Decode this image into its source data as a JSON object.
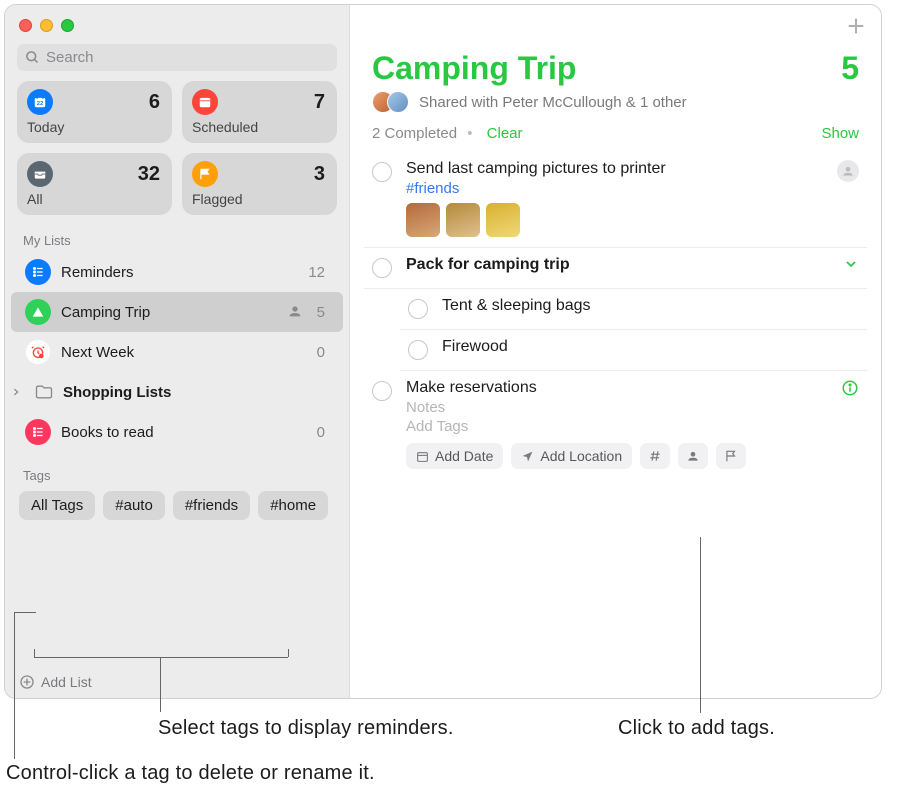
{
  "search": {
    "placeholder": "Search"
  },
  "smart": {
    "today": {
      "label": "Today",
      "count": "6",
      "color": "#0a7aff"
    },
    "scheduled": {
      "label": "Scheduled",
      "count": "7",
      "color": "#ff453a"
    },
    "all": {
      "label": "All",
      "count": "32",
      "color": "#5b6770"
    },
    "flagged": {
      "label": "Flagged",
      "count": "3",
      "color": "#ff9f0a"
    }
  },
  "sidebar": {
    "mylists_header": "My Lists",
    "tags_header": "Tags",
    "lists": [
      {
        "name": "Reminders",
        "count": "12",
        "color": "#0a7aff",
        "icon": "bullet"
      },
      {
        "name": "Camping Trip",
        "count": "5",
        "color": "#30d158",
        "icon": "tent",
        "selected": true,
        "shared": true
      },
      {
        "name": "Next Week",
        "count": "0",
        "color_bg": "#ffffff",
        "icon": "alarm"
      },
      {
        "name": "Shopping Lists",
        "folder": true
      },
      {
        "name": "Books to read",
        "count": "0",
        "color": "#ff375f",
        "icon": "bullet"
      }
    ],
    "tags": [
      {
        "label": "All Tags"
      },
      {
        "label": "#auto"
      },
      {
        "label": "#friends"
      },
      {
        "label": "#home"
      }
    ],
    "add_list": "Add List"
  },
  "main": {
    "title": "Camping Trip",
    "count": "5",
    "shared_text": "Shared with Peter McCullough & 1 other",
    "completed_text": "2 Completed",
    "clear": "Clear",
    "show": "Show",
    "reminders": [
      {
        "title": "Send last camping pictures to printer",
        "tag": "#friends",
        "has_thumbs": true,
        "has_assignee": true
      },
      {
        "title": "Pack for camping trip",
        "bold": true,
        "expandable": true
      },
      {
        "title": "Tent & sleeping bags",
        "sub": true
      },
      {
        "title": "Firewood",
        "sub": true
      },
      {
        "title": "Make reservations",
        "editing": true,
        "notes": "Notes",
        "add_tags": "Add Tags",
        "info": true
      }
    ],
    "quick": {
      "add_date": "Add Date",
      "add_location": "Add Location"
    }
  },
  "callouts": {
    "select_tags": "Select tags to display reminders.",
    "click_add_tags": "Click to add tags.",
    "control_click": "Control-click a tag to delete or rename it."
  }
}
